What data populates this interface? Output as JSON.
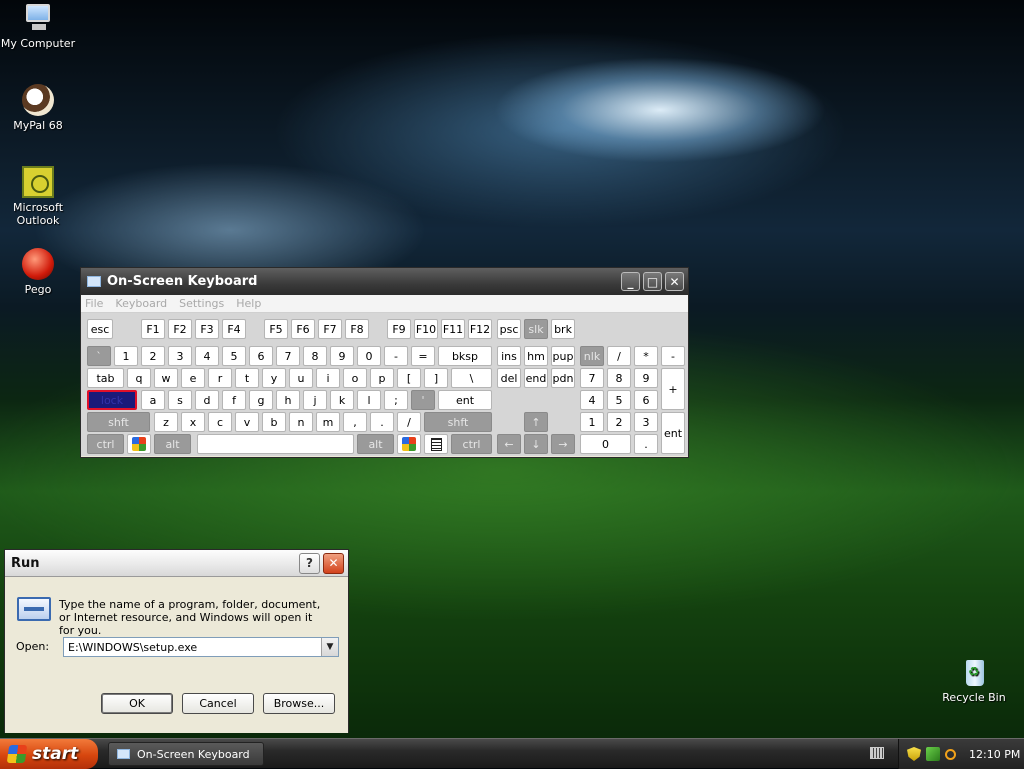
{
  "desktop": {
    "icons": [
      {
        "label": "My Computer"
      },
      {
        "label": "MyPal 68"
      },
      {
        "label": "Microsoft Outlook"
      },
      {
        "label": "Pego"
      },
      {
        "label": "Recycle Bin"
      }
    ]
  },
  "osk": {
    "title": "On-Screen Keyboard",
    "menu": [
      "File",
      "Keyboard",
      "Settings",
      "Help"
    ],
    "keys": {
      "esc": "esc",
      "f1": "F1",
      "f2": "F2",
      "f3": "F3",
      "f4": "F4",
      "f5": "F5",
      "f6": "F6",
      "f7": "F7",
      "f8": "F8",
      "f9": "F9",
      "f10": "F10",
      "f11": "F11",
      "f12": "F12",
      "psc": "psc",
      "slk": "slk",
      "brk": "brk",
      "grave": "`",
      "n1": "1",
      "n2": "2",
      "n3": "3",
      "n4": "4",
      "n5": "5",
      "n6": "6",
      "n7": "7",
      "n8": "8",
      "n9": "9",
      "n0": "0",
      "minus": "-",
      "equals": "=",
      "bksp": "bksp",
      "ins": "ins",
      "hm": "hm",
      "pup": "pup",
      "nlk": "nlk",
      "np_div": "/",
      "np_mul": "*",
      "np_sub": "-",
      "tab": "tab",
      "q": "q",
      "w": "w",
      "e": "e",
      "r": "r",
      "t": "t",
      "y": "y",
      "u": "u",
      "i": "i",
      "o": "o",
      "p": "p",
      "lbr": "[",
      "rbr": "]",
      "bslash": "\\",
      "del": "del",
      "end": "end",
      "pdn": "pdn",
      "np7": "7",
      "np8": "8",
      "np9": "9",
      "np_add": "+",
      "lock": "lock",
      "a": "a",
      "s": "s",
      "d": "d",
      "f": "f",
      "g": "g",
      "h": "h",
      "j": "j",
      "k": "k",
      "l": "l",
      "semi": ";",
      "quote": "'",
      "ent": "ent",
      "np4": "4",
      "np5": "5",
      "np6": "6",
      "lshft": "shft",
      "z": "z",
      "x": "x",
      "c": "c",
      "v": "v",
      "b": "b",
      "n": "n",
      "m": "m",
      "comma": ",",
      "period": ".",
      "slash": "/",
      "rshft": "shft",
      "up": "↑",
      "np1": "1",
      "np2": "2",
      "np3": "3",
      "np_ent": "ent",
      "lctrl": "ctrl",
      "lalt": "alt",
      "ralt": "alt",
      "rctrl": "ctrl",
      "left": "←",
      "down": "↓",
      "right": "→",
      "np0": "0",
      "np_dec": "."
    }
  },
  "run": {
    "title": "Run",
    "help_btn": "?",
    "description": "Type the name of a program, folder, document, or Internet resource, and Windows will open it for you.",
    "open_label": "Open:",
    "open_value": "E:\\WINDOWS\\setup.exe",
    "ok": "OK",
    "cancel": "Cancel",
    "browse": "Browse..."
  },
  "taskbar": {
    "start": "start",
    "task_button": "On-Screen Keyboard",
    "clock": "12:10 PM"
  }
}
